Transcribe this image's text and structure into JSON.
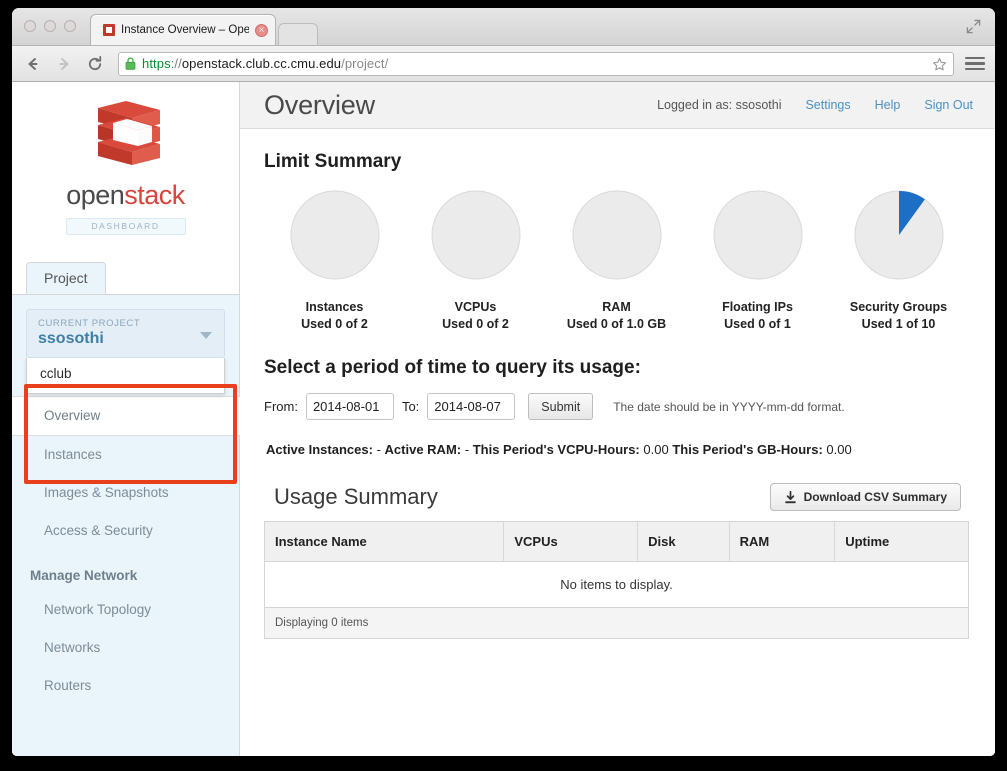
{
  "browser": {
    "tab_title": "Instance Overview – OpenS",
    "url": {
      "scheme": "https",
      "separator": "://",
      "host": "openstack.club.cc.cmu.edu",
      "path": "/project/"
    },
    "icons": {
      "back": "back-arrow-icon",
      "forward": "forward-arrow-icon",
      "reload": "reload-icon",
      "lock": "padlock-icon",
      "star": "star-icon",
      "menu": "hamburger-menu-icon",
      "fullscreen": "fullscreen-icon",
      "tab_close": "×"
    }
  },
  "sidebar": {
    "logo": {
      "word_open": "open",
      "word_stack": "stack",
      "badge": "DASHBOARD"
    },
    "tab": "Project",
    "project_selector": {
      "label": "CURRENT PROJECT",
      "current": "ssosothi",
      "options": [
        "cclub"
      ]
    },
    "nav": [
      {
        "label": "Overview",
        "active": true
      },
      {
        "label": "Instances",
        "active": false
      },
      {
        "label": "Images & Snapshots",
        "active": false
      },
      {
        "label": "Access & Security",
        "active": false
      }
    ],
    "network_heading": "Manage Network",
    "network_nav": [
      {
        "label": "Network Topology"
      },
      {
        "label": "Networks"
      },
      {
        "label": "Routers"
      }
    ],
    "highlight_color": "#e8401c"
  },
  "topbar": {
    "title": "Overview",
    "logged_in": "Logged in as: ssosothi",
    "links": [
      "Settings",
      "Help",
      "Sign Out"
    ],
    "link_color": "#4b90c5"
  },
  "limit_summary": {
    "heading": "Limit Summary"
  },
  "chart_data": {
    "type": "pie",
    "title": "Limit Summary",
    "legend_position": "none",
    "used_color": "#1c6fc4",
    "free_color": "#ebebeb",
    "charts": [
      {
        "label": "Instances",
        "sub": "Used 0 of 2",
        "used": 0,
        "total": 2,
        "percent": 0
      },
      {
        "label": "VCPUs",
        "sub": "Used 0 of 2",
        "used": 0,
        "total": 2,
        "percent": 0
      },
      {
        "label": "RAM",
        "sub": "Used 0 of 1.0 GB",
        "used": 0,
        "total": 1,
        "percent": 0
      },
      {
        "label": "Floating IPs",
        "sub": "Used 0 of 1",
        "used": 0,
        "total": 1,
        "percent": 0
      },
      {
        "label": "Security Groups",
        "sub": "Used 1 of 10",
        "used": 1,
        "total": 10,
        "percent": 10
      }
    ]
  },
  "query": {
    "heading": "Select a period of time to query its usage:",
    "from_label": "From:",
    "from_value": "2014-08-01",
    "to_label": "To:",
    "to_value": "2014-08-07",
    "submit_label": "Submit",
    "hint": "The date should be in YYYY-mm-dd format."
  },
  "stats": {
    "active_instances_label": "Active Instances:",
    "active_instances_value": "-",
    "active_ram_label": "Active RAM:",
    "active_ram_value": "-",
    "vcpu_hours_label": "This Period's VCPU-Hours:",
    "vcpu_hours_value": "0.00",
    "gb_hours_label": "This Period's GB-Hours:",
    "gb_hours_value": "0.00"
  },
  "usage": {
    "title": "Usage Summary",
    "download_label": "Download CSV Summary",
    "download_icon": "download-icon",
    "columns": [
      "Instance Name",
      "VCPUs",
      "Disk",
      "RAM",
      "Uptime"
    ],
    "empty_message": "No items to display.",
    "footer": "Displaying 0 items"
  }
}
